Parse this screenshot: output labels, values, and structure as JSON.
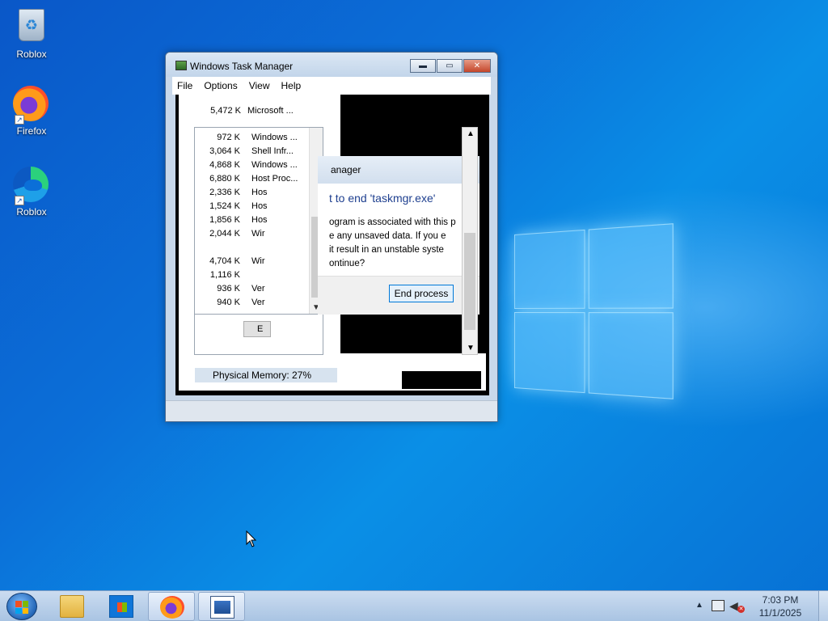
{
  "desktop": {
    "icons": [
      {
        "label": "Roblox",
        "icon": "recycle-bin-icon"
      },
      {
        "label": "Firefox",
        "icon": "firefox-icon"
      },
      {
        "label": "Roblox",
        "icon": "edge-icon"
      }
    ]
  },
  "task_manager": {
    "title": "Windows Task Manager",
    "menu": [
      "File",
      "Options",
      "View",
      "Help"
    ],
    "caption_buttons": {
      "minimize": "▬",
      "maximize": "▭",
      "close": "✕"
    },
    "background_rows": [
      {
        "mem": "5,472 K",
        "desc": "Microsoft ..."
      }
    ],
    "process_rows": [
      {
        "mem": "972 K",
        "desc": "Windows ..."
      },
      {
        "mem": "3,064 K",
        "desc": "Shell Infr..."
      },
      {
        "mem": "4,868 K",
        "desc": "Windows ..."
      },
      {
        "mem": "6,880 K",
        "desc": "Host Proc..."
      },
      {
        "mem": "2,336 K",
        "desc": "Hos"
      },
      {
        "mem": "1,524 K",
        "desc": "Hos"
      },
      {
        "mem": "1,856 K",
        "desc": "Hos"
      },
      {
        "mem": "2,044 K",
        "desc": "Wir"
      },
      {
        "mem": "",
        "desc": ""
      },
      {
        "mem": "4,704 K",
        "desc": "Wir"
      },
      {
        "mem": "1,116 K",
        "desc": ""
      },
      {
        "mem": "936 K",
        "desc": "Ver"
      },
      {
        "mem": "940 K",
        "desc": "Ver"
      }
    ],
    "ghost_button": "E",
    "physical_memory": "Physical Memory: 27%"
  },
  "dialog": {
    "title_fragment": "anager",
    "heading": "t to end 'taskmgr.exe'",
    "message": [
      "ogram is associated with this p",
      "e any unsaved data. If you e",
      "it result in an unstable syste",
      "ontinue?"
    ],
    "button": "End process"
  },
  "taskbar": {
    "time": "7:03 PM",
    "date": "11/1/2025",
    "items": [
      "file-explorer-icon",
      "store-icon",
      "firefox-icon",
      "task-manager-icon"
    ],
    "active_index": 2
  }
}
